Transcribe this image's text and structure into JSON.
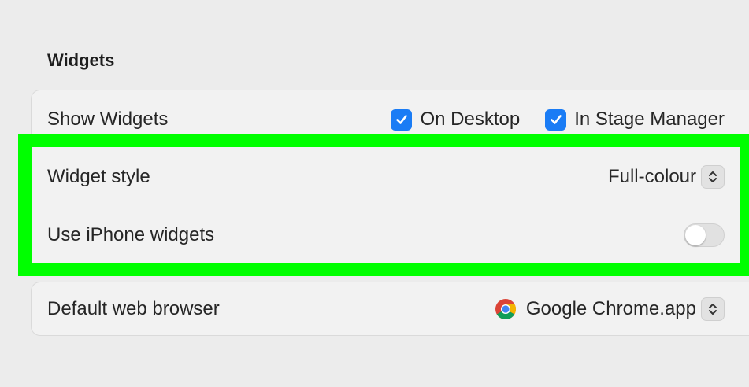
{
  "section": {
    "title": "Widgets"
  },
  "show_widgets": {
    "label": "Show Widgets",
    "on_desktop": {
      "label": "On Desktop",
      "checked": true
    },
    "in_stage_manager": {
      "label": "In Stage Manager",
      "checked": true
    }
  },
  "widget_style": {
    "label": "Widget style",
    "value": "Full-colour"
  },
  "iphone_widgets": {
    "label": "Use iPhone widgets",
    "enabled": false
  },
  "default_browser": {
    "label": "Default web browser",
    "value": "Google Chrome.app",
    "icon": "chrome-icon"
  },
  "colors": {
    "accent": "#1a7cf5",
    "highlight": "#00ff00"
  }
}
